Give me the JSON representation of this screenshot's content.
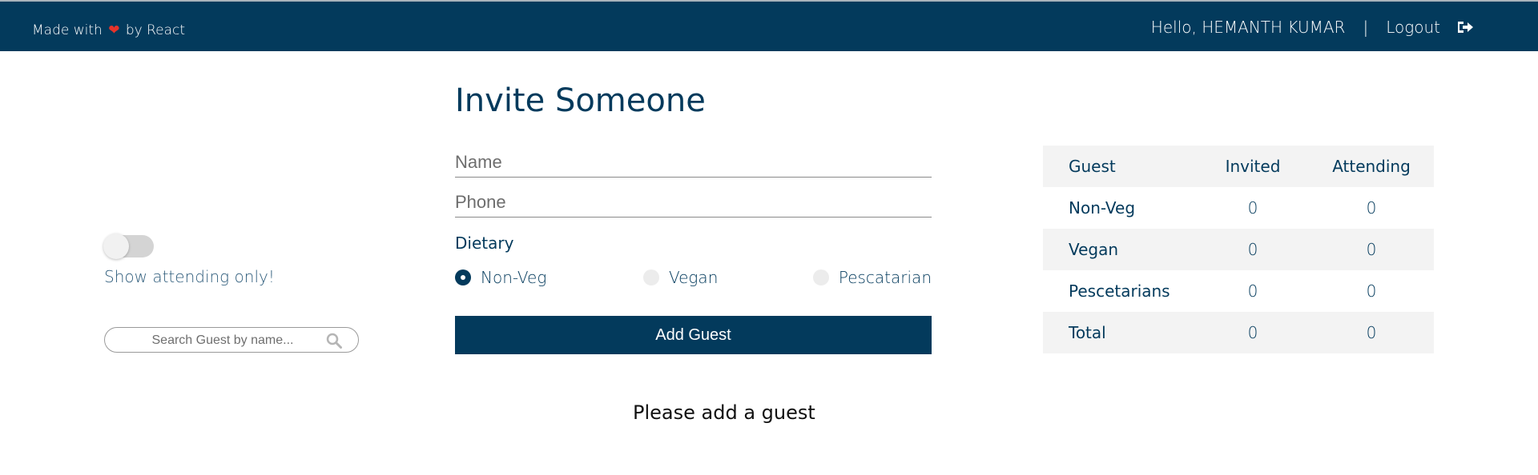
{
  "header": {
    "made_with_prefix": "Made with",
    "made_with_suffix": "by React",
    "greeting": "Hello, HEMANTH KUMAR",
    "separator": "|",
    "logout_label": "Logout"
  },
  "filters": {
    "toggle_label": "Show attending only!",
    "toggle_on": false,
    "search_placeholder": "Search Guest by name..."
  },
  "invite_form": {
    "title": "Invite Someone",
    "name_placeholder": "Name",
    "phone_placeholder": "Phone",
    "dietary_label": "Dietary",
    "options": [
      "Non-Veg",
      "Vegan",
      "Pescatarian"
    ],
    "selected_option": "Non-Veg",
    "submit_label": "Add Guest"
  },
  "guest_list": {
    "empty_message": "Please add a guest"
  },
  "summary_table": {
    "headers": [
      "Guest",
      "Invited",
      "Attending"
    ],
    "rows": [
      {
        "label": "Non-Veg",
        "invited": "0",
        "attending": "0"
      },
      {
        "label": "Vegan",
        "invited": "0",
        "attending": "0"
      },
      {
        "label": "Pescetarians",
        "invited": "0",
        "attending": "0"
      },
      {
        "label": "Total",
        "invited": "0",
        "attending": "0"
      }
    ]
  },
  "colors": {
    "primary": "#033a5c",
    "heart": "#e7332a",
    "table_stripe": "#f3f3f3"
  },
  "icons": [
    "heart-icon",
    "logout-icon",
    "search-icon"
  ]
}
